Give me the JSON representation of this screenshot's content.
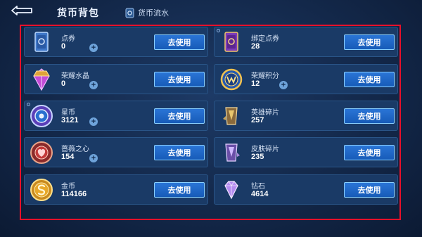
{
  "header": {
    "title": "货币背包",
    "tab_ledger": "货币流水"
  },
  "cards": [
    {
      "name": "点券",
      "value": "0",
      "button": "去使用",
      "icon": "coupon-card-icon",
      "has_plus": true
    },
    {
      "name": "绑定点券",
      "value": "28",
      "button": "去使用",
      "icon": "bound-coupon-card-icon",
      "has_plus": false
    },
    {
      "name": "荣耀水晶",
      "value": "0",
      "button": "去使用",
      "icon": "glory-crystal-icon",
      "has_plus": true
    },
    {
      "name": "荣耀积分",
      "value": "12",
      "button": "去使用",
      "icon": "glory-points-icon",
      "has_plus": true
    },
    {
      "name": "星币",
      "value": "3121",
      "button": "去使用",
      "icon": "star-coin-icon",
      "has_plus": true
    },
    {
      "name": "英雄碎片",
      "value": "257",
      "button": "去使用",
      "icon": "hero-fragment-icon",
      "has_plus": false
    },
    {
      "name": "蔷薇之心",
      "value": "154",
      "button": "去使用",
      "icon": "rose-heart-icon",
      "has_plus": true
    },
    {
      "name": "皮肤碎片",
      "value": "235",
      "button": "去使用",
      "icon": "skin-fragment-icon",
      "has_plus": false
    },
    {
      "name": "金币",
      "value": "114166",
      "button": "去使用",
      "icon": "gold-coin-icon",
      "has_plus": false
    },
    {
      "name": "钻石",
      "value": "4614",
      "button": "去使用",
      "icon": "diamond-icon",
      "has_plus": false
    }
  ],
  "colors": {
    "highlight": "#e8102a",
    "button": "#2a75d6",
    "card": "#1a3a66"
  }
}
